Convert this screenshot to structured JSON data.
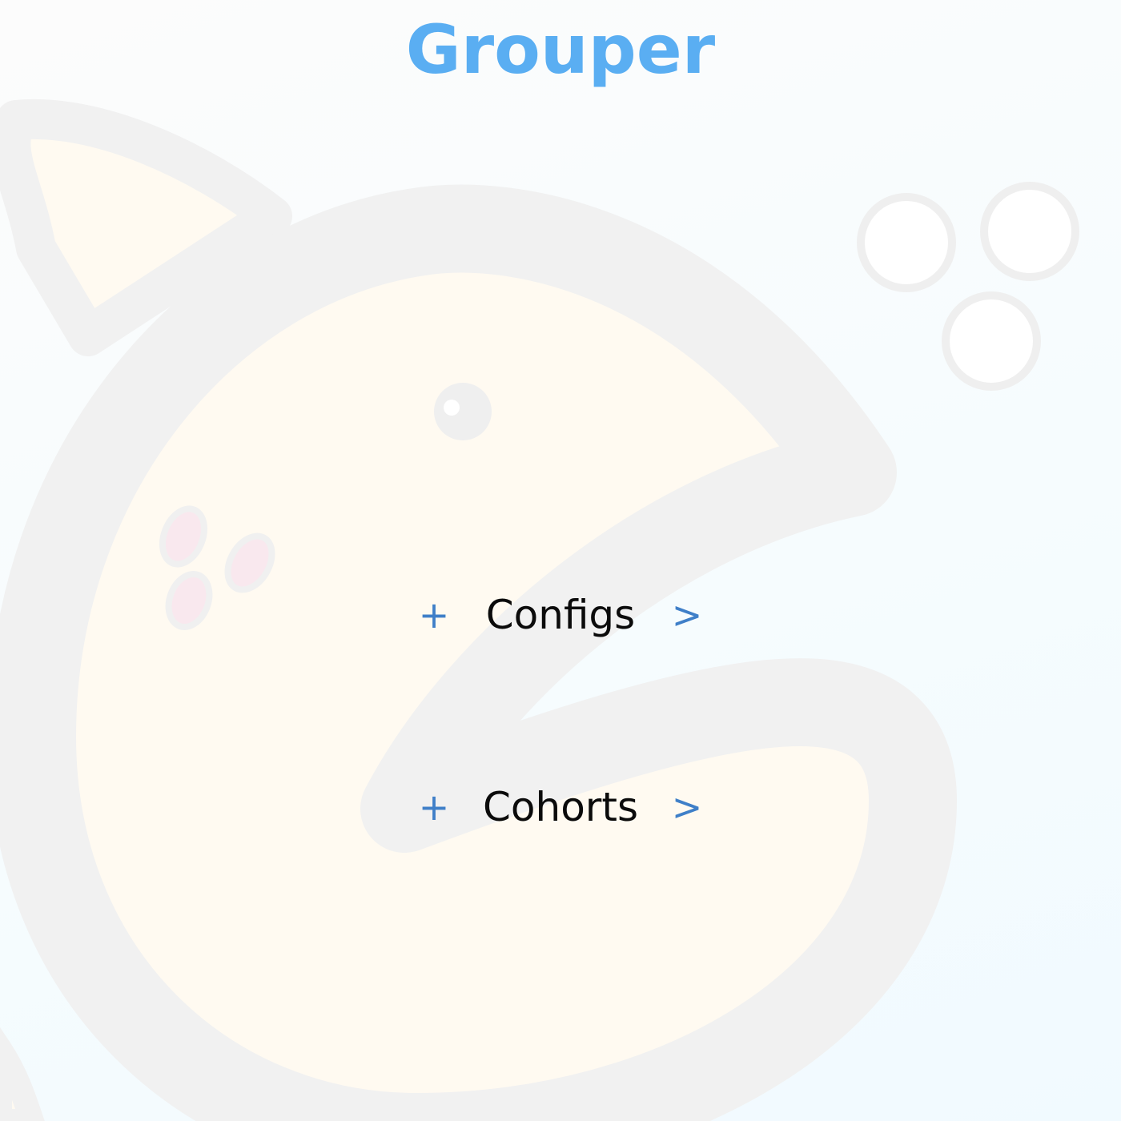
{
  "app": {
    "title": "Grouper"
  },
  "menu": {
    "items": [
      {
        "label": "Configs",
        "add_icon": "+",
        "open_icon": ">"
      },
      {
        "label": "Cohorts",
        "add_icon": "+",
        "open_icon": ">"
      }
    ]
  },
  "icons": {
    "add": "plus-icon",
    "open": "chevron-right-icon",
    "background": "grouper-fish-mascot"
  },
  "colors": {
    "title": "#5aaef2",
    "accent": "#3f7fc8",
    "label": "#0b0b0b",
    "mascot_outline": "#f0f0f0",
    "mascot_fill": "#fffaf1",
    "mascot_spots": "#f9e8ee"
  }
}
